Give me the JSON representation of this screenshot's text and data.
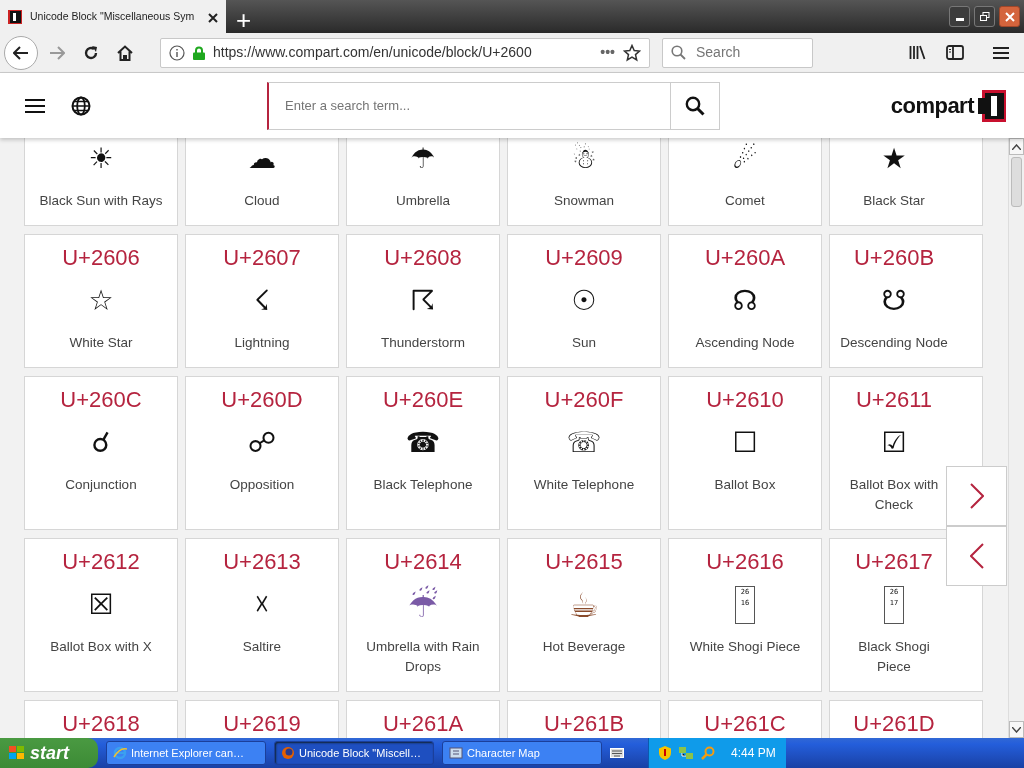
{
  "browser": {
    "tabs": [
      {
        "title": "Unicode Block \"Miscellaneous Sym",
        "selected": true
      }
    ],
    "new_tab": "+",
    "forward_disabled": true,
    "url": "https://www.compart.com/en/unicode/block/U+2600",
    "page_actions": "•••",
    "search": {
      "placeholder": "Search"
    }
  },
  "site": {
    "search": {
      "placeholder": "Enter a search term..."
    },
    "logo": "compart"
  },
  "grid": [
    {
      "glyph": "☀",
      "name": "Black Sun with Rays",
      "kind": "char"
    },
    {
      "glyph": "☁",
      "name": "Cloud",
      "kind": "char"
    },
    {
      "glyph": "☂",
      "name": "Umbrella",
      "kind": "char"
    },
    {
      "glyph": "☃",
      "name": "Snowman",
      "kind": "char"
    },
    {
      "glyph": "☄",
      "name": "Comet",
      "kind": "char"
    },
    {
      "glyph": "★",
      "name": "Black Star",
      "kind": "char"
    },
    {
      "code": "U+2606",
      "glyph": "☆",
      "name": "White Star",
      "kind": "char"
    },
    {
      "code": "U+2607",
      "glyph": "☇",
      "name": "Lightning",
      "kind": "char"
    },
    {
      "code": "U+2608",
      "glyph": "☈",
      "name": "Thunderstorm",
      "kind": "char"
    },
    {
      "code": "U+2609",
      "glyph": "☉",
      "name": "Sun",
      "kind": "char"
    },
    {
      "code": "U+260A",
      "glyph": "☊",
      "name": "Ascending Node",
      "kind": "char"
    },
    {
      "code": "U+260B",
      "glyph": "☋",
      "name": "Descending Node",
      "kind": "char"
    },
    {
      "code": "U+260C",
      "glyph": "☌",
      "name": "Conjunction",
      "kind": "char"
    },
    {
      "code": "U+260D",
      "glyph": "☍",
      "name": "Opposition",
      "kind": "char"
    },
    {
      "code": "U+260E",
      "glyph": "☎",
      "name": "Black Telephone",
      "kind": "char"
    },
    {
      "code": "U+260F",
      "glyph": "☏",
      "name": "White Telephone",
      "kind": "char"
    },
    {
      "code": "U+2610",
      "glyph": "☐",
      "name": "Ballot Box",
      "kind": "char"
    },
    {
      "code": "U+2611",
      "glyph": "☑",
      "name": "Ballot Box with Check",
      "kind": "char"
    },
    {
      "code": "U+2612",
      "glyph": "☒",
      "name": "Ballot Box with X",
      "kind": "char"
    },
    {
      "code": "U+2613",
      "glyph": "☓",
      "name": "Saltire",
      "kind": "char"
    },
    {
      "code": "U+2614",
      "glyph": "☔",
      "name": "Umbrella with Rain Drops",
      "kind": "emoji",
      "color": "#7a5aa6"
    },
    {
      "code": "U+2615",
      "glyph": "☕",
      "name": "Hot Beverage",
      "kind": "emoji",
      "color": "#8a4b2c"
    },
    {
      "code": "U+2616",
      "glyph": "2616",
      "name": "White Shogi Piece",
      "kind": "missing"
    },
    {
      "code": "U+2617",
      "glyph": "2617",
      "name": "Black Shogi Piece",
      "kind": "missing"
    },
    {
      "code": "U+2618"
    },
    {
      "code": "U+2619"
    },
    {
      "code": "U+261A"
    },
    {
      "code": "U+261B"
    },
    {
      "code": "U+261C"
    },
    {
      "code": "U+261D"
    }
  ],
  "taskbar": {
    "start": "start",
    "tasks": [
      {
        "label": "Internet Explorer can…",
        "selected": false,
        "kind": "ie"
      },
      {
        "label": "Unicode Block \"Miscell…",
        "selected": true,
        "kind": "firefox"
      },
      {
        "label": "Character Map",
        "selected": false,
        "kind": "charmap"
      }
    ],
    "clock": "4:44 PM"
  }
}
